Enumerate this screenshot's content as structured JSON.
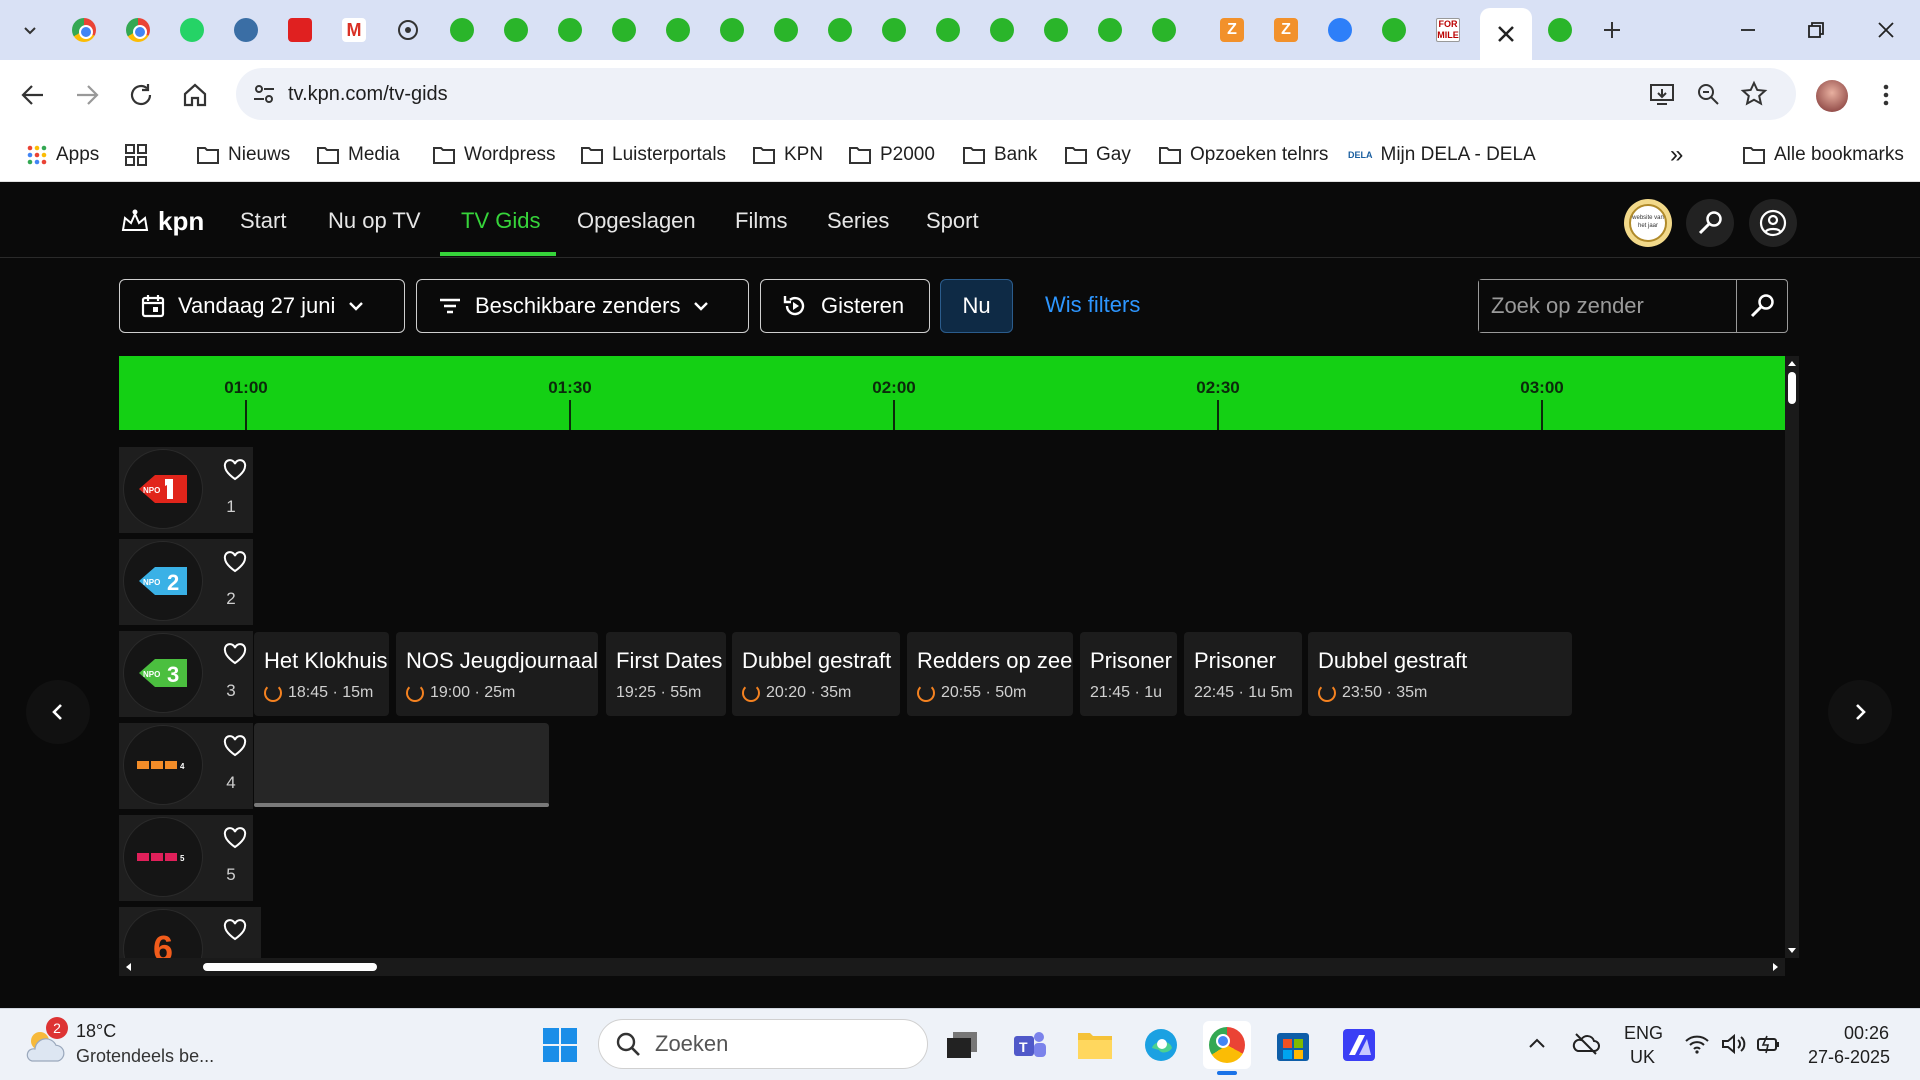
{
  "browser": {
    "url": "tv.kpn.com/tv-gids",
    "bookmarks": [
      {
        "label": "Apps",
        "icon": "apps-grid-icon"
      },
      {
        "label": "",
        "icon": "tab-grid-icon"
      },
      {
        "label": "Nieuws",
        "icon": "folder-icon"
      },
      {
        "label": "Media",
        "icon": "folder-icon"
      },
      {
        "label": "Wordpress",
        "icon": "folder-icon"
      },
      {
        "label": "Luisterportals",
        "icon": "folder-icon"
      },
      {
        "label": "KPN",
        "icon": "folder-icon"
      },
      {
        "label": "P2000",
        "icon": "folder-icon"
      },
      {
        "label": "Bank",
        "icon": "folder-icon"
      },
      {
        "label": "Gay",
        "icon": "folder-icon"
      },
      {
        "label": "Opzoeken telnrs",
        "icon": "folder-icon"
      },
      {
        "label": "Mijn DELA - DELA",
        "icon": "dela-icon"
      }
    ],
    "overflow_label": "»",
    "all_bookmarks": "Alle bookmarks",
    "fm_tab_label": "FOR MILE"
  },
  "site": {
    "logo": "kpn",
    "nav": [
      "Start",
      "Nu op TV",
      "TV Gids",
      "Opgeslagen",
      "Films",
      "Series",
      "Sport"
    ],
    "active_nav": "TV Gids",
    "award_badge": "website van het jaar"
  },
  "filters": {
    "date": "Vandaag 27 juni",
    "channels": "Beschikbare zenders",
    "yesterday": "Gisteren",
    "now": "Nu",
    "clear": "Wis filters",
    "search_placeholder": "Zoek op zender"
  },
  "timeline": {
    "ticks": [
      "01:00",
      "01:30",
      "02:00",
      "02:30",
      "03:00"
    ]
  },
  "channels": [
    {
      "number": "1",
      "logo": "NPO 1"
    },
    {
      "number": "2",
      "logo": "NPO 2"
    },
    {
      "number": "3",
      "logo": "NPO 3"
    },
    {
      "number": "4",
      "logo": "RTL 4"
    },
    {
      "number": "5",
      "logo": "RTL 5"
    },
    {
      "number": "6",
      "logo": "6"
    }
  ],
  "programs_ch3": [
    {
      "title": "Het Klokhuis",
      "meta": "18:45 · 15m",
      "replay": true
    },
    {
      "title": "NOS Jeugdjournaal",
      "meta": "19:00 · 25m",
      "replay": true
    },
    {
      "title": "First Dates",
      "meta": "19:25 · 55m",
      "replay": false
    },
    {
      "title": "Dubbel gestraft",
      "meta": "20:20 · 35m",
      "replay": true
    },
    {
      "title": "Redders op zee",
      "meta": "20:55 · 50m",
      "replay": true
    },
    {
      "title": "Prisoner",
      "meta": "21:45 · 1u",
      "replay": false
    },
    {
      "title": "Prisoner",
      "meta": "22:45 · 1u 5m",
      "replay": false
    },
    {
      "title": "Dubbel gestraft",
      "meta": "23:50 · 35m",
      "replay": true
    }
  ],
  "taskbar": {
    "weather_temp": "18°C",
    "weather_desc": "Grotendeels be...",
    "weather_badge": "2",
    "search_placeholder": "Zoeken",
    "lang_1": "ENG",
    "lang_2": "UK",
    "time": "00:26",
    "date": "27-6-2025"
  },
  "colors": {
    "kpn_green": "#14d014",
    "accent_link": "#2d96ff",
    "replay_orange": "#f58220"
  }
}
